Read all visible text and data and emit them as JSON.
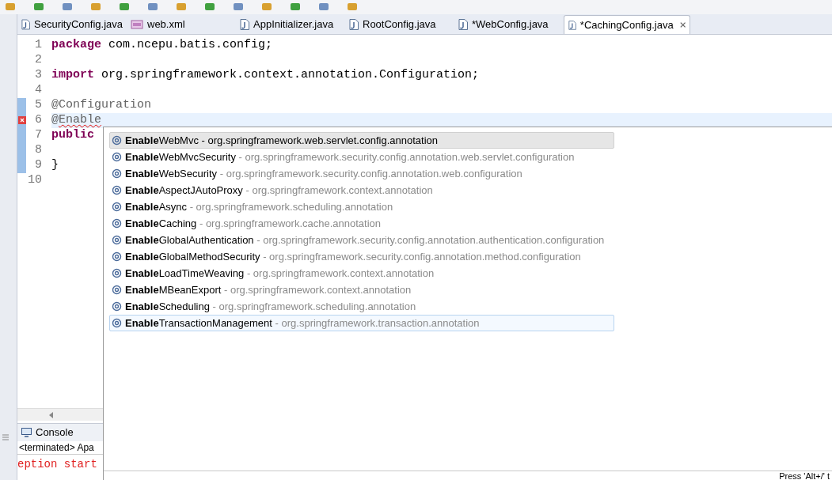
{
  "tabs": [
    {
      "label": "SecurityConfig.java",
      "kind": "java",
      "selected": false
    },
    {
      "label": "web.xml",
      "kind": "xml",
      "selected": false
    },
    {
      "label": "AppInitializer.java",
      "kind": "java",
      "selected": false
    },
    {
      "label": "RootConfig.java",
      "kind": "java",
      "selected": false
    },
    {
      "label": "*WebConfig.java",
      "kind": "java",
      "selected": false
    },
    {
      "label": "*CachingConfig.java",
      "kind": "java",
      "selected": true
    }
  ],
  "editor": {
    "lines": [
      {
        "number": "1",
        "changed": false,
        "error": false,
        "current": false,
        "tokens": [
          {
            "text": "package",
            "kind": "keyword"
          },
          {
            "text": " com.ncepu.batis.config;",
            "kind": "plain"
          }
        ]
      },
      {
        "number": "2",
        "changed": false,
        "error": false,
        "current": false
      },
      {
        "number": "3",
        "changed": false,
        "error": false,
        "current": false,
        "tokens": [
          {
            "text": "import",
            "kind": "keyword"
          },
          {
            "text": " org.springframework.context.annotation.Configuration;",
            "kind": "plain"
          }
        ]
      },
      {
        "number": "4",
        "changed": false,
        "error": false,
        "current": false
      },
      {
        "number": "5",
        "changed": true,
        "error": false,
        "current": false,
        "tokens": [
          {
            "text": "@Configuration",
            "kind": "annotation"
          }
        ]
      },
      {
        "number": "6",
        "changed": true,
        "error": true,
        "current": true,
        "tokens": [
          {
            "text": "@",
            "kind": "annotation"
          },
          {
            "text": "Enable",
            "kind": "squiggle"
          }
        ]
      },
      {
        "number": "7",
        "changed": true,
        "error": false,
        "current": false,
        "tokens": [
          {
            "text": "public",
            "kind": "keyword"
          }
        ]
      },
      {
        "number": "8",
        "changed": true,
        "error": false,
        "current": false
      },
      {
        "number": "9",
        "changed": true,
        "error": false,
        "current": false,
        "tokens": [
          {
            "text": "}",
            "kind": "plain"
          }
        ]
      },
      {
        "number": "10",
        "changed": false,
        "error": false,
        "current": false
      }
    ]
  },
  "console": {
    "title": "Console",
    "status": "<terminated> Apa",
    "lines": [
      "eption start"
    ]
  },
  "completion": {
    "proposals": [
      {
        "name": "**Enable**WebMvc",
        "package": "- org.springframework.web.servlet.config.annotation",
        "selected": true,
        "hovered": false
      },
      {
        "name": "**Enable**WebMvcSecurity",
        "package": "- org.springframework.security.config.annotation.web.servlet.configuration",
        "selected": false,
        "hovered": false
      },
      {
        "name": "**Enable**WebSecurity",
        "package": "- org.springframework.security.config.annotation.web.configuration",
        "selected": false,
        "hovered": false
      },
      {
        "name": "**Enable**AspectJAutoProxy",
        "package": "- org.springframework.context.annotation",
        "selected": false,
        "hovered": false
      },
      {
        "name": "**Enable**Async",
        "package": "- org.springframework.scheduling.annotation",
        "selected": false,
        "hovered": false
      },
      {
        "name": "**Enable**Caching",
        "package": "- org.springframework.cache.annotation",
        "selected": false,
        "hovered": false
      },
      {
        "name": "**Enable**GlobalAuthentication",
        "package": "- org.springframework.security.config.annotation.authentication.configuration",
        "selected": false,
        "hovered": false
      },
      {
        "name": "**Enable**GlobalMethodSecurity",
        "package": "- org.springframework.security.config.annotation.method.configuration",
        "selected": false,
        "hovered": false
      },
      {
        "name": "**Enable**LoadTimeWeaving",
        "package": "- org.springframework.context.annotation",
        "selected": false,
        "hovered": false
      },
      {
        "name": "**Enable**MBeanExport",
        "package": "- org.springframework.context.annotation",
        "selected": false,
        "hovered": false
      },
      {
        "name": "**Enable**Scheduling",
        "package": "- org.springframework.scheduling.annotation",
        "selected": false,
        "hovered": false
      },
      {
        "name": "**Enable**TransactionManagement",
        "package": "- org.springframework.transaction.annotation",
        "selected": false,
        "hovered": true
      }
    ],
    "status": "Press 'Alt+/' t"
  }
}
